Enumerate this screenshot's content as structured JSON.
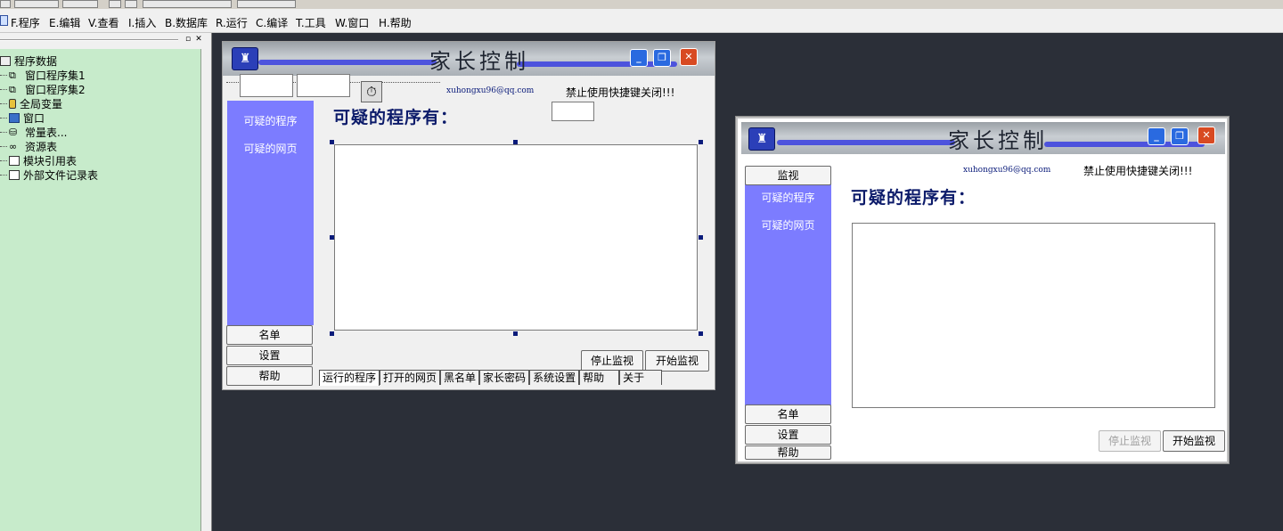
{
  "menubar": {
    "items": [
      "F.程序",
      "E.编辑",
      "V.查看",
      "I.插入",
      "B.数据库",
      "R.运行",
      "C.编译",
      "T.工具",
      "W.窗口",
      "H.帮助"
    ]
  },
  "project_tree": {
    "root": "程序数据",
    "items": [
      "窗口程序集1",
      "窗口程序集2",
      "全局变量",
      "窗口",
      "常量表...",
      "资源表",
      "模块引用表",
      "外部文件记录表"
    ]
  },
  "app": {
    "banner_title": "家长控制",
    "email": "xuhongxu96@qq.com",
    "notice": "禁止使用快捷键关闭!!!",
    "heading": "可疑的程序有：",
    "side_links": [
      "可疑的程序",
      "可疑的网页"
    ],
    "monitor_button": "监视",
    "list_button": "名单",
    "settings_button": "设置",
    "help_button": "帮助",
    "stop_button": "停止监视",
    "start_button": "开始监视",
    "tabs": [
      "运行的程序",
      "打开的网页",
      "黑名单",
      "家长密码",
      "系统设置",
      "帮助",
      "关于"
    ]
  },
  "colors": {
    "sidebar": "#7c7cff",
    "tree_bg": "#c7ebcb",
    "desktop": "#2b2f38",
    "heading": "#0c1b6a"
  }
}
